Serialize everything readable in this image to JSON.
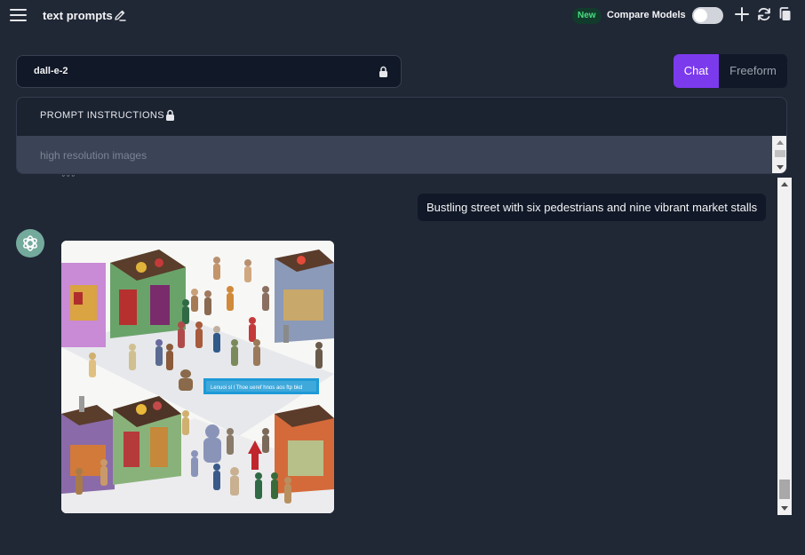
{
  "header": {
    "title": "text prompts",
    "new_badge": "New",
    "compare_label": "Compare Models",
    "compare_enabled": false
  },
  "model": {
    "name": "dall-e-2",
    "locked": true
  },
  "tabs": [
    {
      "label": "Chat",
      "active": true
    },
    {
      "label": "Freeform",
      "active": false
    }
  ],
  "prompt_instructions": {
    "heading": "PROMPT INSTRUCTIONS",
    "text": "high resolution images"
  },
  "messages": {
    "user_text": "Bustling street with six pedestrians and nine vibrant market stalls",
    "image_banner_text": "Lenuoi sl l Thoe ueref hnos aos ftp bkd"
  },
  "icons": {
    "menu": "hamburger-icon",
    "edit": "pencil-icon",
    "add": "plus-icon",
    "refresh": "refresh-icon",
    "copy": "copy-icon",
    "lock": "lock-icon",
    "avatar": "openai-logo-icon"
  },
  "colors": {
    "background": "#202735",
    "accent": "#7c3aed",
    "badge_text": "#4ade80",
    "avatar": "#74aa9c"
  }
}
